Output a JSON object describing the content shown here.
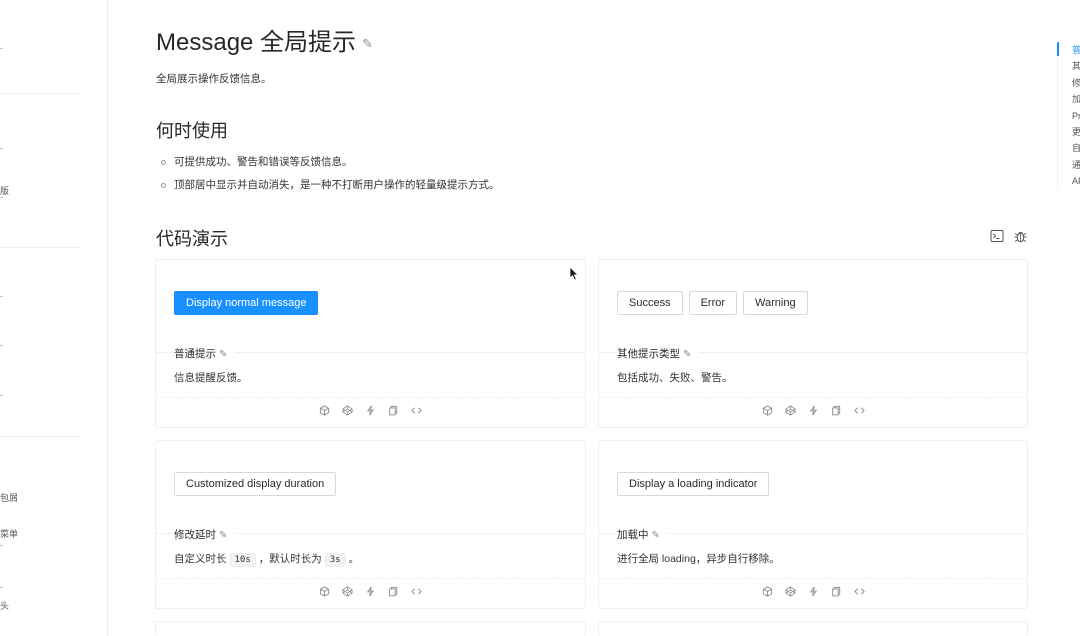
{
  "sidebar": {
    "fragments": [
      "版",
      "包屑",
      "菜单",
      "头"
    ]
  },
  "page": {
    "title": "Message 全局提示",
    "description": "全局展示操作反馈信息。"
  },
  "when_to_use": {
    "heading": "何时使用",
    "items": [
      "可提供成功、警告和错误等反馈信息。",
      "顶部居中显示并自动消失，是一种不打断用户操作的轻量级提示方式。"
    ]
  },
  "demos": {
    "heading": "代码演示",
    "cards": [
      {
        "buttons": [
          "Display normal message"
        ],
        "title": "普通提示",
        "desc": "信息提醒反馈。"
      },
      {
        "buttons": [
          "Success",
          "Error",
          "Warning"
        ],
        "title": "其他提示类型",
        "desc": "包括成功、失败、警告。"
      },
      {
        "buttons": [
          "Customized display duration"
        ],
        "title": "修改延时",
        "desc_parts": [
          "自定义时长",
          "10s",
          "，默认时长为",
          "3s",
          "。"
        ]
      },
      {
        "buttons": [
          "Display a loading indicator"
        ],
        "title": "加载中",
        "desc": "进行全局 loading，异步自行移除。"
      }
    ]
  },
  "anchor_nav": {
    "items": [
      "普",
      "其",
      "修",
      "加",
      "Pr",
      "更",
      "自",
      "通",
      "AP"
    ],
    "active_index": 0
  },
  "colors": {
    "primary": "#1890ff",
    "text": "rgba(0,0,0,0.85)",
    "border": "#f0f0f0"
  }
}
